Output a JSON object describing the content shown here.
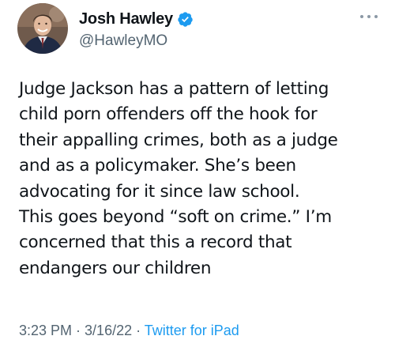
{
  "author": {
    "display_name": "Josh Hawley",
    "handle": "@HawleyMO",
    "verified_icon": "verified-badge-icon",
    "verified_color": "#1d9bf0"
  },
  "tweet": {
    "text_lines": [
      "Judge Jackson has a pattern of letting",
      "child porn offenders off the hook for",
      "their appalling crimes, both as a judge",
      "and as a policymaker. She’s been",
      "advocating for it since law school.",
      "This goes beyond “soft on crime.” I’m",
      "concerned that this a record that",
      "endangers our children"
    ]
  },
  "meta": {
    "time": "3:23 PM",
    "separator_1": " · ",
    "date": "3/16/22",
    "separator_2": " · ",
    "source": "Twitter for iPad"
  },
  "icons": {
    "more": "more-horizontal-icon"
  },
  "colors": {
    "text": "#0f1419",
    "secondary": "#536471",
    "accent": "#1d9bf0"
  }
}
